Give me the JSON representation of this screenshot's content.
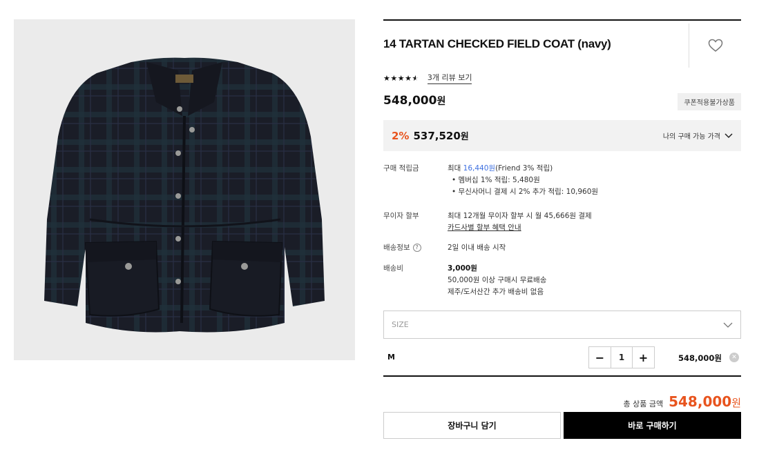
{
  "product": {
    "image_alt": "navy tartan checked field coat",
    "title": "14 TARTAN CHECKED FIELD COAT (navy)",
    "rating": 4.5,
    "stars": "★★★★★",
    "review_link": "3개 리뷰 보기",
    "price": "548,000",
    "price_unit": "원",
    "coupon_badge": "쿠폰적용불가상품"
  },
  "discount": {
    "rate": "2%",
    "price": "537,520",
    "unit": "원",
    "my_price_label": "나의 구매 가능 가격"
  },
  "info": {
    "points": {
      "label": "구매 적립금",
      "prefix": "최대 ",
      "amount": "16,440원",
      "suffix": "(Friend 3% 적립)",
      "bullets": [
        "• 멤버십 1% 적립: 5,480원",
        "• 무신사머니 결제 시 2% 추가 적립: 10,960원"
      ]
    },
    "installment": {
      "label": "무이자 할부",
      "line1": "최대 12개월 무이자 할부 시 월 45,666원 결제",
      "link": "카드사별 할부 혜택 안내"
    },
    "shipping_info": {
      "label": "배송정보",
      "help": "?",
      "value": "2일 이내 배송 시작"
    },
    "shipping_fee": {
      "label": "배송비",
      "fee": "3,000원",
      "line2": "50,000원 이상 구매시 무료배송",
      "line3": "제주/도서산간 추가 배송비 없음"
    }
  },
  "size_select": {
    "placeholder": "SIZE"
  },
  "option": {
    "name": "M",
    "minus": "−",
    "quantity": "1",
    "plus": "+",
    "price": "548,000원",
    "remove": "✕"
  },
  "total": {
    "label": "총 상품 금액",
    "amount": "548,000",
    "unit": "원"
  },
  "buttons": {
    "cart": "장바구니 담기",
    "buy": "바로 구매하기"
  },
  "colors": {
    "accent": "#e8541e",
    "link_blue": "#3d6fe0",
    "coat": "#1c1f2a"
  }
}
